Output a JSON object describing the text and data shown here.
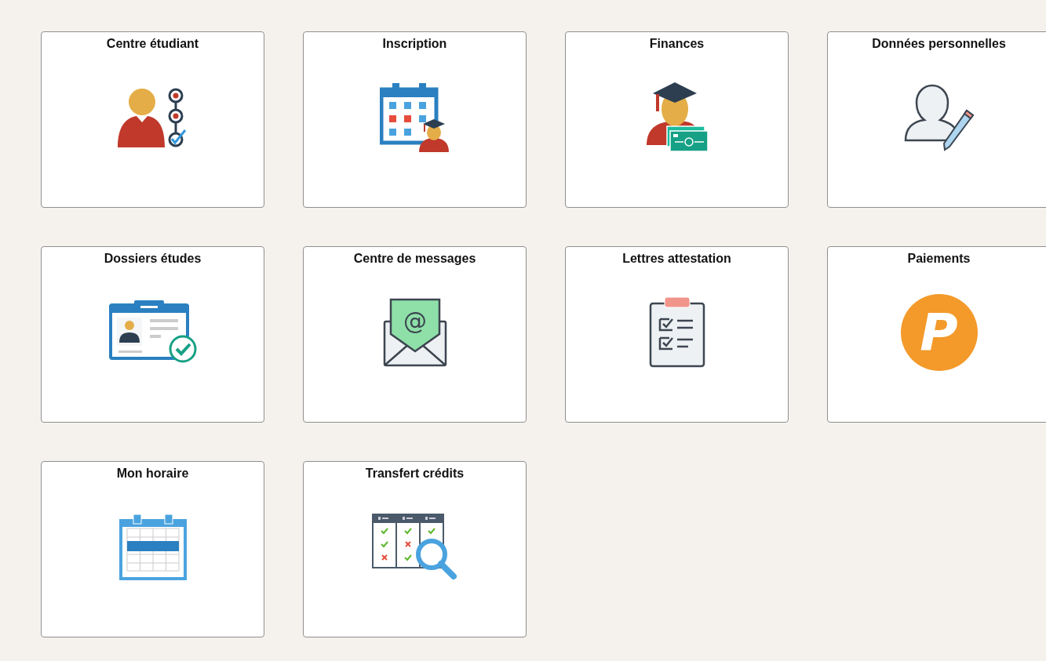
{
  "tiles": [
    {
      "title": "Centre étudiant",
      "kind": "student-center"
    },
    {
      "title": "Inscription",
      "kind": "enrollment"
    },
    {
      "title": "Finances",
      "kind": "finances"
    },
    {
      "title": "Données personnelles",
      "kind": "personal-data"
    },
    {
      "title": "Dossiers études",
      "kind": "academic-records"
    },
    {
      "title": "Centre de messages",
      "kind": "messages",
      "icon_glyph": "@"
    },
    {
      "title": "Lettres attestation",
      "kind": "letters"
    },
    {
      "title": "Paiements",
      "kind": "payments",
      "logo_letter": "P"
    },
    {
      "title": "Mon horaire",
      "kind": "schedule"
    },
    {
      "title": "Transfert crédits",
      "kind": "transfer-credits"
    }
  ]
}
